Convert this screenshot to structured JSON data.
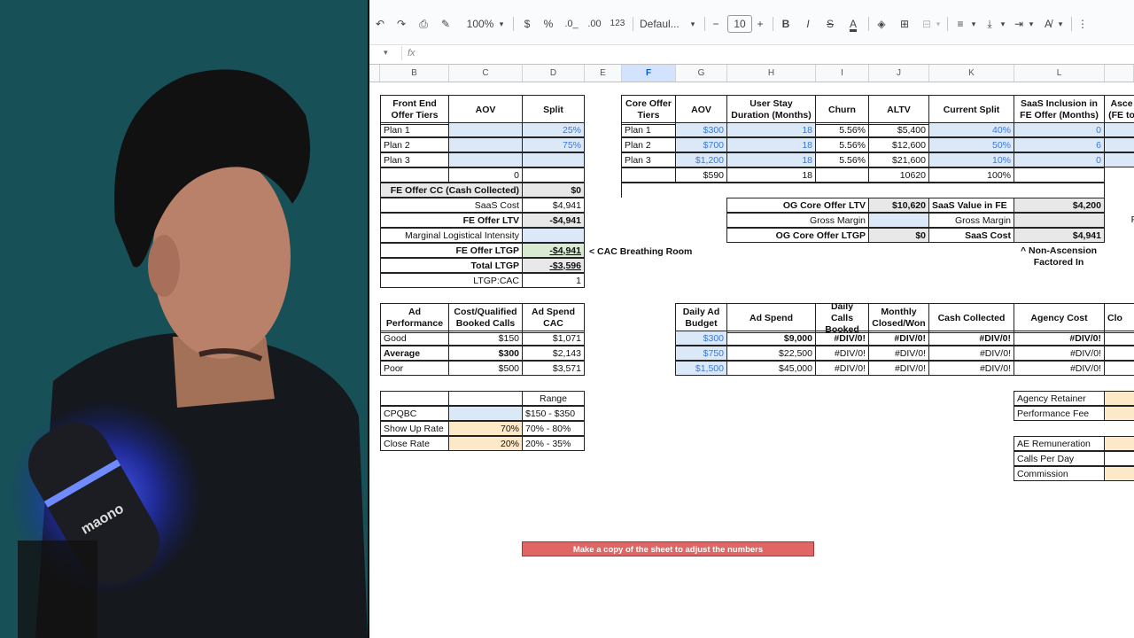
{
  "toolbar": {
    "zoom": "100%",
    "currency": "$",
    "percent": "%",
    "dec_down": ".0_",
    "dec_up": ".00",
    "format_123": "123",
    "font": "Defaul...",
    "font_size": "10",
    "minus": "−",
    "plus": "+",
    "bold": "B",
    "italic": "I",
    "strike": "S",
    "text_color": "A",
    "more": "⋮"
  },
  "formula_bar": {
    "fx": "fx"
  },
  "columns": [
    "B",
    "C",
    "D",
    "E",
    "F",
    "G",
    "H",
    "I",
    "J",
    "K",
    "L"
  ],
  "fe_tiers": {
    "headers": [
      "Front End Offer Tiers",
      "AOV",
      "Split"
    ],
    "rows": [
      {
        "name": "Plan 1",
        "aov": "",
        "split": "25%"
      },
      {
        "name": "Plan 2",
        "aov": "",
        "split": "75%"
      },
      {
        "name": "Plan 3",
        "aov": "",
        "split": ""
      }
    ],
    "total_aov": "0",
    "cc_label": "FE Offer CC (Cash Collected)",
    "cc_value": "$0",
    "saas_cost_label": "SaaS Cost",
    "saas_cost_value": "$4,941",
    "ltv_label": "FE Offer LTV",
    "ltv_value": "-$4,941",
    "mli_label": "Marginal Logistical Intensity",
    "mli_value": "",
    "ltgp_label": "FE Offer LTGP",
    "ltgp_value": "-$4,941",
    "total_ltgp_label": "Total LTGP",
    "total_ltgp_value": "-$3,596",
    "ltgp_cac_label": "LTGP:CAC",
    "ltgp_cac_value": "1",
    "breathing_note": "< CAC Breathing Room"
  },
  "core_tiers": {
    "headers": [
      "Core Offer Tiers",
      "AOV",
      "User Stay Duration (Months)",
      "Churn",
      "ALTV",
      "Current Split",
      "SaaS Inclusion in FE Offer (Months)",
      "Asce (FE to"
    ],
    "rows": [
      {
        "name": "Plan 1",
        "aov": "$300",
        "stay": "18",
        "churn": "5.56%",
        "altv": "$5,400",
        "split": "40%",
        "saas": "0"
      },
      {
        "name": "Plan 2",
        "aov": "$700",
        "stay": "18",
        "churn": "5.56%",
        "altv": "$12,600",
        "split": "50%",
        "saas": "6"
      },
      {
        "name": "Plan 3",
        "aov": "$1,200",
        "stay": "18",
        "churn": "5.56%",
        "altv": "$21,600",
        "split": "10%",
        "saas": "0"
      }
    ],
    "totals": {
      "aov": "$590",
      "stay": "18",
      "altv": "10620",
      "split": "100%"
    },
    "og_ltv_label": "OG Core Offer LTV",
    "og_ltv_value": "$10,620",
    "saas_fe_label": "SaaS Value in FE",
    "saas_fe_value": "$4,200",
    "gm_label": "Gross Margin",
    "gm_label2": "Gross Margin",
    "og_ltgp_label": "OG Core Offer LTGP",
    "og_ltgp_value": "$0",
    "saas_cost_label": "SaaS Cost",
    "saas_cost_value": "$4,941",
    "non_ascension_note": "^ Non-Ascension Factored In",
    "edge_f": "F"
  },
  "ad_perf": {
    "headers": [
      "Ad Performance",
      "Cost/Qualified Booked Calls",
      "Ad Spend CAC"
    ],
    "rows": [
      {
        "name": "Good",
        "cost": "$150",
        "cac": "$1,071"
      },
      {
        "name": "Average",
        "cost": "$300",
        "cac": "$2,143"
      },
      {
        "name": "Poor",
        "cost": "$500",
        "cac": "$3,571"
      }
    ]
  },
  "daily_ad": {
    "headers": [
      "Daily Ad Budget",
      "Ad Spend",
      "Daily Calls Booked",
      "Monthly Closed/Won",
      "Cash Collected",
      "Agency Cost",
      "Clo"
    ],
    "rows": [
      {
        "budget": "$300",
        "spend": "$9,000",
        "calls": "#DIV/0!",
        "closed": "#DIV/0!",
        "cash": "#DIV/0!",
        "agency": "#DIV/0!"
      },
      {
        "budget": "$750",
        "spend": "$22,500",
        "calls": "#DIV/0!",
        "closed": "#DIV/0!",
        "cash": "#DIV/0!",
        "agency": "#DIV/0!"
      },
      {
        "budget": "$1,500",
        "spend": "$45,000",
        "calls": "#DIV/0!",
        "closed": "#DIV/0!",
        "cash": "#DIV/0!",
        "agency": "#DIV/0!"
      }
    ]
  },
  "ranges": {
    "header": "Range",
    "rows": [
      {
        "name": "CPQBC",
        "value": "",
        "range": "$150 - $350"
      },
      {
        "name": "Show Up Rate",
        "value": "70%",
        "range": "70% - 80%"
      },
      {
        "name": "Close Rate",
        "value": "20%",
        "range": "20% - 35%"
      }
    ]
  },
  "agency": {
    "rows": [
      "Agency Retainer",
      "Performance Fee",
      "",
      "AE Remuneration",
      "Calls Per Day",
      "Commission"
    ]
  },
  "cta_label": "Make a copy of the sheet to adjust the numbers",
  "cam": {
    "mic_brand": "maono"
  }
}
